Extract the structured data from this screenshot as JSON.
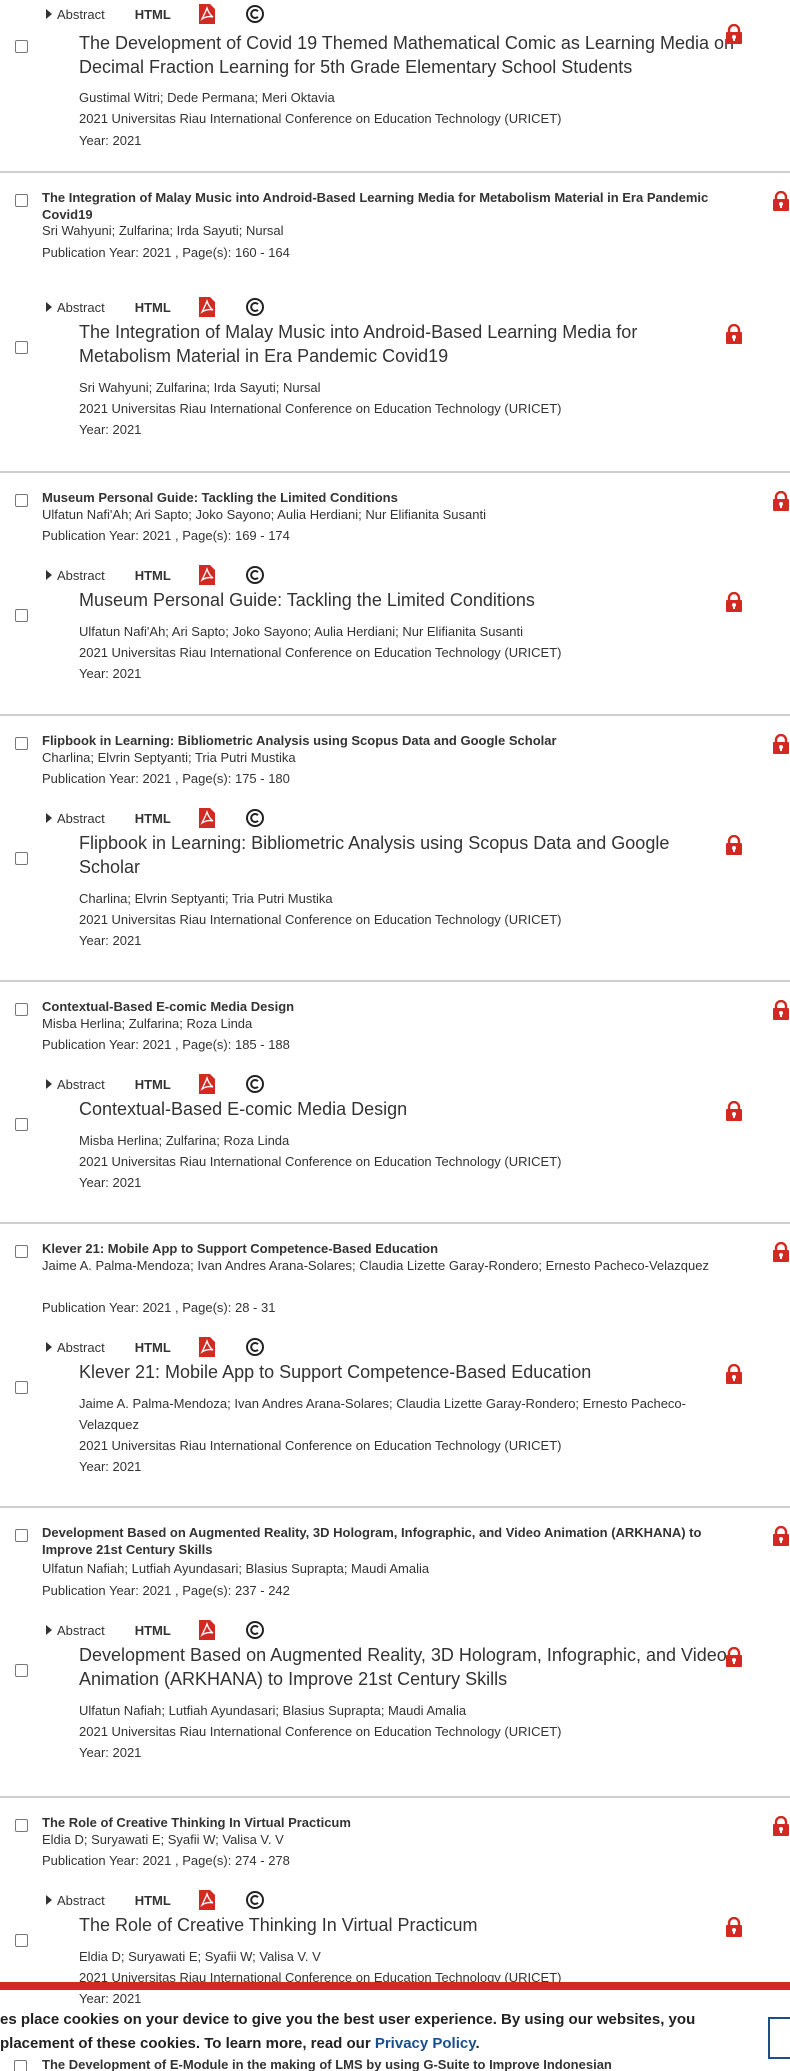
{
  "labels": {
    "abstract": "Abstract",
    "html": "HTML",
    "publication_prefix": "Publication Year: 2021 , Page(s): "
  },
  "colors": {
    "accent_red": "#d22a22",
    "link_blue": "#1a4f8c"
  },
  "icons": {
    "lock": "lock-icon",
    "pdf": "pdf-icon",
    "copyright": "copyright-icon",
    "caret": "caret-right-icon"
  },
  "top": {
    "title": "The Development of Covid 19 Themed Mathematical Comic as Learning Media on Decimal Fraction Learning for 5th Grade Elementary School Students",
    "authors": "Gustimal Witri; Dede Permana; Meri Oktavia",
    "conference": "2021 Universitas Riau International Conference on Education Technology (URICET)",
    "year": "Year: 2021"
  },
  "articles": [
    {
      "compact_title": "The Integration of Malay Music into Android-Based Learning Media for Metabolism Material in Era Pandemic Covid19",
      "compact_authors": "Sri Wahyuni; Zulfarina; Irda Sayuti; Nursal",
      "pub": "Publication Year: 2021 , Page(s): 160  -  164",
      "title": "The Integration of Malay Music into Android-Based Learning Media for Metabolism Material in Era Pandemic Covid19",
      "authors": "Sri Wahyuni; Zulfarina; Irda Sayuti; Nursal",
      "conference": "2021 Universitas Riau International Conference on Education Technology (URICET)",
      "year": "Year: 2021"
    },
    {
      "compact_title": "Museum Personal Guide: Tackling the Limited Conditions",
      "compact_authors": "Ulfatun Nafi'Ah; Ari Sapto; Joko Sayono; Aulia Herdiani; Nur Elifianita Susanti",
      "pub": "Publication Year: 2021 , Page(s): 169  -  174",
      "title": "Museum Personal Guide: Tackling the Limited Conditions",
      "authors": "Ulfatun Nafi'Ah; Ari Sapto; Joko Sayono; Aulia Herdiani; Nur Elifianita Susanti",
      "conference": "2021 Universitas Riau International Conference on Education Technology (URICET)",
      "year": "Year: 2021"
    },
    {
      "compact_title": "Flipbook in Learning: Bibliometric Analysis using Scopus Data and Google Scholar",
      "compact_authors": "Charlina; Elvrin Septyanti; Tria Putri Mustika",
      "pub": "Publication Year: 2021 , Page(s): 175  -  180",
      "title": "Flipbook in Learning: Bibliometric Analysis using Scopus Data and Google Scholar",
      "authors": "Charlina; Elvrin Septyanti; Tria Putri Mustika",
      "conference": "2021 Universitas Riau International Conference on Education Technology (URICET)",
      "year": "Year: 2021"
    },
    {
      "compact_title": "Contextual-Based E-comic Media Design",
      "compact_authors": "Misba Herlina; Zulfarina; Roza Linda",
      "pub": "Publication Year: 2021 , Page(s): 185  -  188",
      "title": "Contextual-Based E-comic Media Design",
      "authors": "Misba Herlina; Zulfarina; Roza Linda",
      "conference": "2021 Universitas Riau International Conference on Education Technology (URICET)",
      "year": "Year: 2021"
    },
    {
      "compact_title": "Klever 21: Mobile App to Support Competence-Based Education",
      "compact_authors": "Jaime A. Palma-Mendoza; Ivan Andres Arana-Solares; Claudia Lizette Garay-Rondero; Ernesto Pacheco-Velazquez",
      "pub": "Publication Year: 2021 , Page(s): 28  -  31",
      "title": "Klever 21: Mobile App to Support Competence-Based Education",
      "authors": "Jaime A. Palma-Mendoza; Ivan Andres Arana-Solares; Claudia Lizette Garay-Rondero; Ernesto Pacheco-Velazquez",
      "conference": "2021 Universitas Riau International Conference on Education Technology (URICET)",
      "year": "Year: 2021"
    },
    {
      "compact_title": "Development Based on Augmented Reality, 3D Hologram, Infographic, and Video Animation (ARKHANA) to Improve 21st Century Skills",
      "compact_authors": "Ulfatun Nafiah; Lutfiah Ayundasari; Blasius Suprapta; Maudi Amalia",
      "pub": "Publication Year: 2021 , Page(s): 237  -  242",
      "title": "Development Based on Augmented Reality, 3D Hologram, Infographic, and Video Animation (ARKHANA) to Improve 21st Century Skills",
      "authors": "Ulfatun Nafiah; Lutfiah Ayundasari; Blasius Suprapta; Maudi Amalia",
      "conference": "2021 Universitas Riau International Conference on Education Technology (URICET)",
      "year": "Year: 2021"
    },
    {
      "compact_title": "The Role of Creative Thinking In Virtual Practicum",
      "compact_authors": "Eldia D; Suryawati E; Syafii W; Valisa V. V",
      "pub": "Publication Year: 2021 , Page(s): 274  -  278",
      "title": "The Role of Creative Thinking In Virtual Practicum",
      "authors": "Eldia D; Suryawati E; Syafii W; Valisa V. V",
      "conference": "2021 Universitas Riau International Conference on Education Technology (URICET)",
      "year": "Year: 2021"
    }
  ],
  "cookie": {
    "line1": "es place cookies on your device to give you the best user experience. By using our websites, you",
    "line2_prefix": "placement of these cookies. To learn more, read our ",
    "link": "Privacy Policy",
    "line2_suffix": "."
  },
  "last": {
    "title": "The Development of E-Module in the making of LMS by using G-Suite to Improve Indonesian"
  }
}
